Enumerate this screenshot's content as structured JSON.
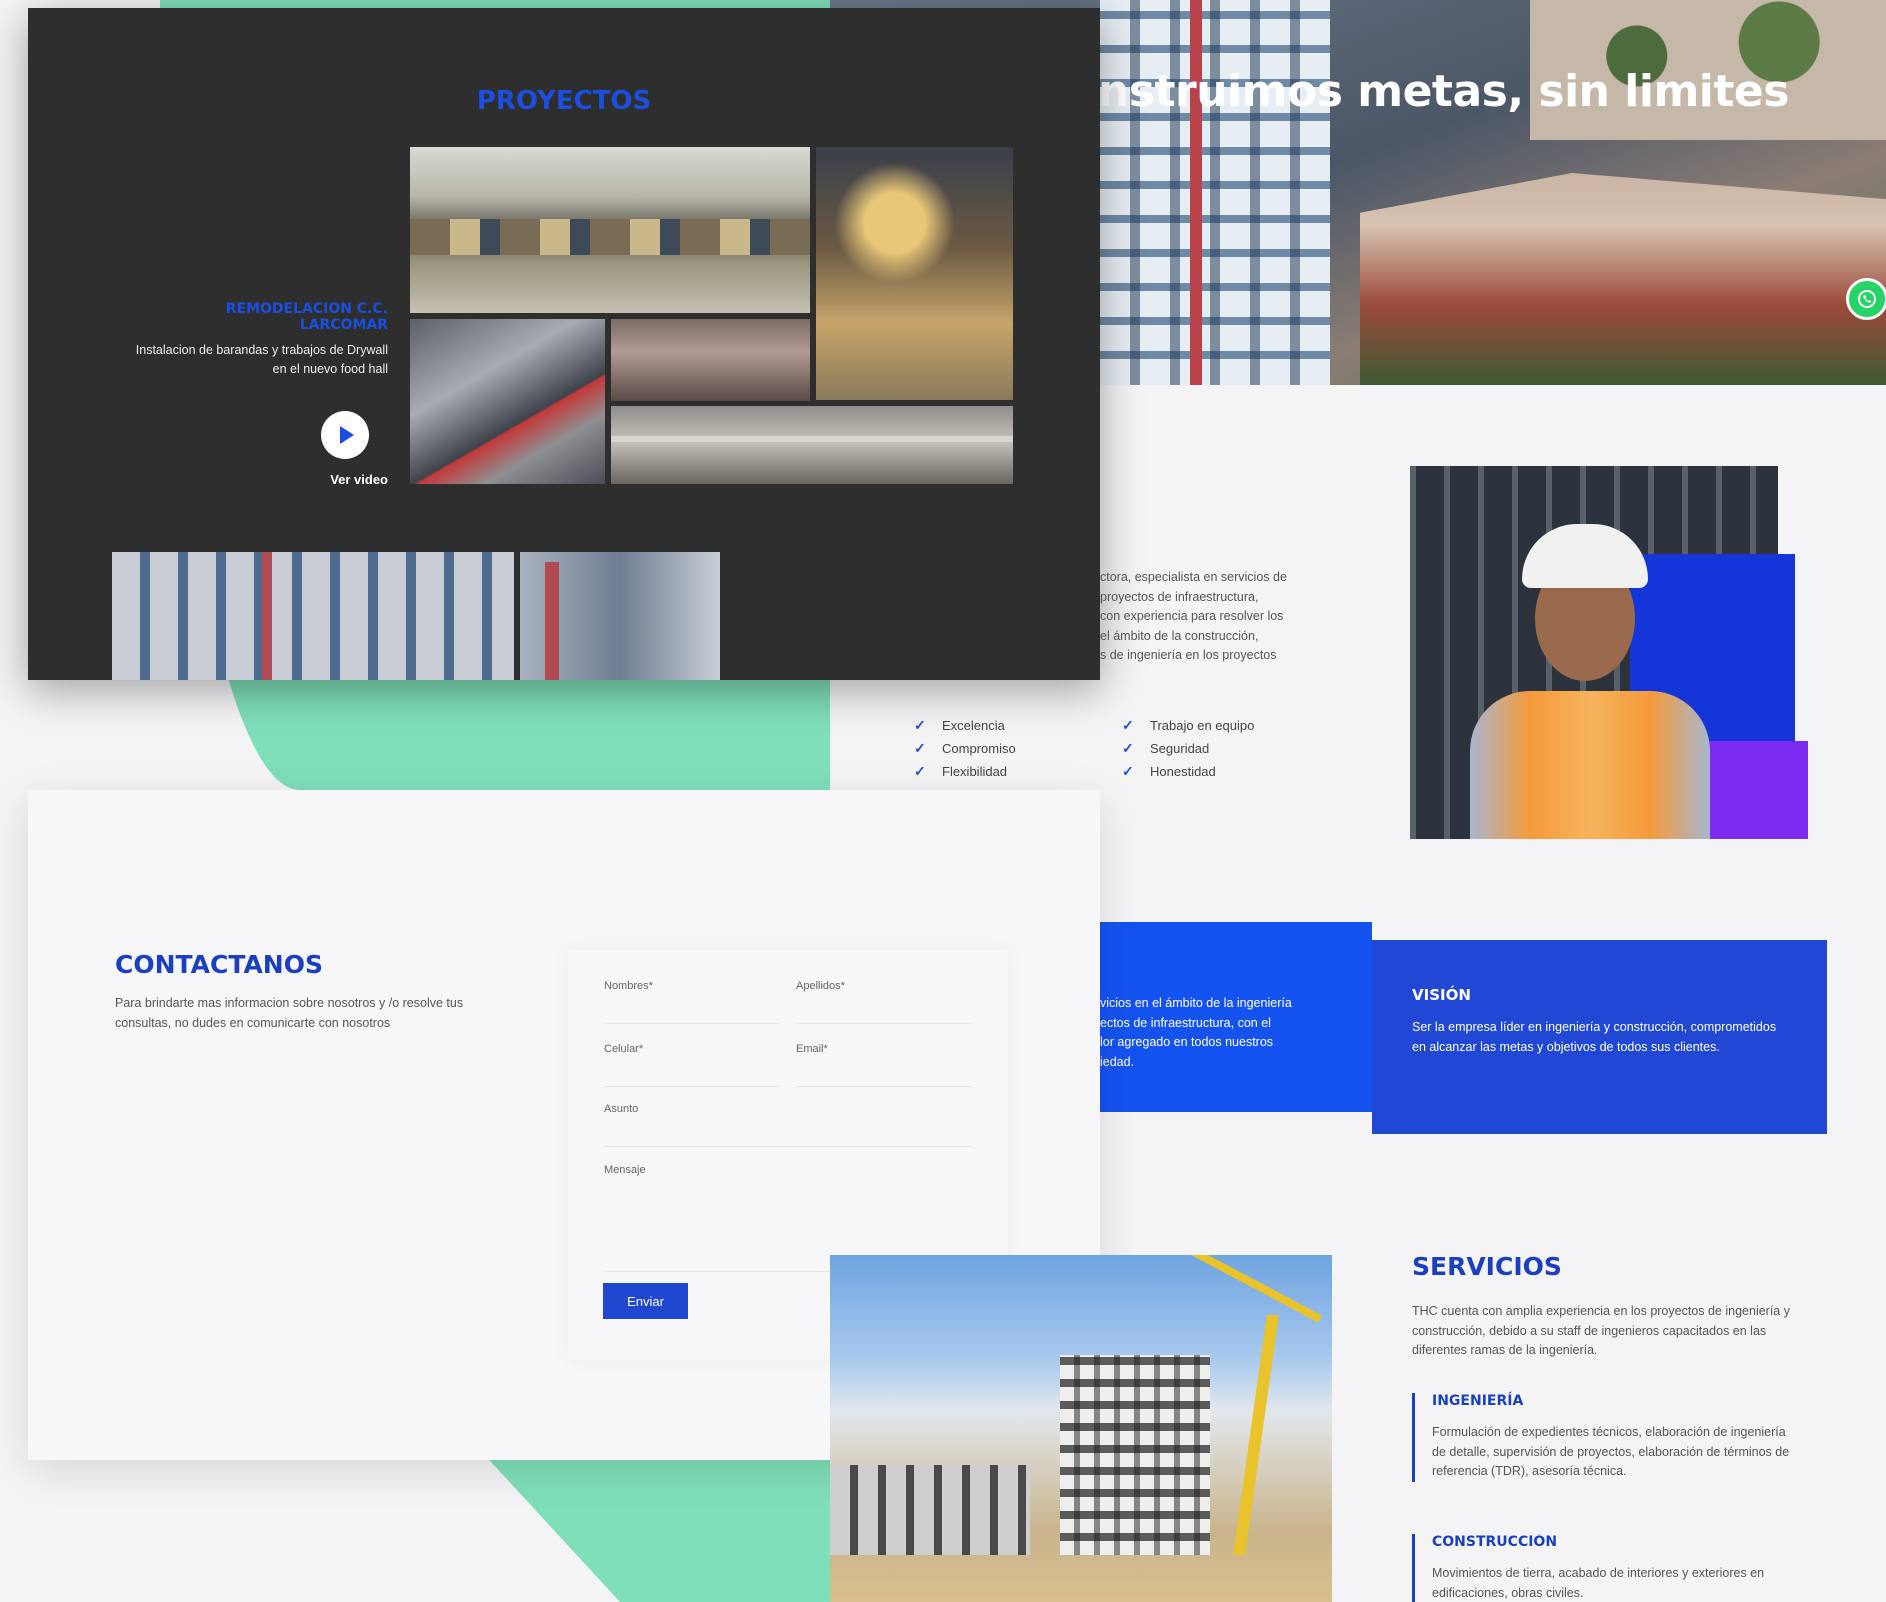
{
  "colors": {
    "brand_blue": "#1a4fe0",
    "mint": "#7fdfb8",
    "dark_card": "#2e2e2e",
    "mission_blue": "#1553f0",
    "vision_blue": "#2148d4",
    "purple": "#7d2bf0"
  },
  "hero": {
    "headline": "nstruimos metas, sin limites",
    "whatsapp_icon": "whatsapp-icon"
  },
  "projects": {
    "title": "PROYECTOS",
    "item_title": "REMODELACION C.C. LARCOMAR",
    "item_desc": "Instalacion de barandas y trabajos de Drywall en el nuevo food hall",
    "video_label": "Ver video"
  },
  "about": {
    "lines": [
      "ctora, especialista en servicios de",
      "proyectos de infraestructura,",
      "con experiencia para resolver los",
      "el ámbito de la construcción,",
      "s de ingeniería en los proyectos"
    ],
    "values_left": [
      "Excelencia",
      "Compromiso",
      "Flexibilidad"
    ],
    "values_right": [
      "Trabajo en equipo",
      "Seguridad",
      "Honestidad"
    ]
  },
  "mission": {
    "lines": [
      "vicios en el ámbito de la ingeniería",
      "ectos de infraestructura, con el",
      "lor agregado en todos nuestros",
      "iedad."
    ]
  },
  "vision": {
    "title": "VISIÓN",
    "text": "Ser la empresa líder en ingeniería y construcción, comprometidos en alcanzar las metas y objetivos de todos sus clientes."
  },
  "contact": {
    "title": "CONTACTANOS",
    "desc": "Para brindarte mas informacion sobre nosotros y /o resolve tus consultas, no dudes en comunicarte con nosotros",
    "form": {
      "nombres": "Nombres*",
      "apellidos": "Apellidos*",
      "celular": "Celular*",
      "email": "Email*",
      "asunto": "Asunto",
      "mensaje": "Mensaje",
      "submit": "Enviar"
    }
  },
  "services": {
    "title": "SERVICIOS",
    "desc": "THC cuenta con amplia experiencia en los proyectos de ingeniería y construcción, debido a su staff de ingenieros capacitados en las diferentes ramas de la ingeniería.",
    "items": [
      {
        "title": "INGENIERÍA",
        "text": "Formulación de expedientes técnicos, elaboración de ingeniería de detalle, supervisión de proyectos, elaboración de términos de referencia (TDR), asesoría técnica."
      },
      {
        "title": "CONSTRUCCIÓN",
        "text": "Movimientos de tierra, acabado de interiores y exteriores en edificaciones, obras civiles."
      }
    ]
  }
}
